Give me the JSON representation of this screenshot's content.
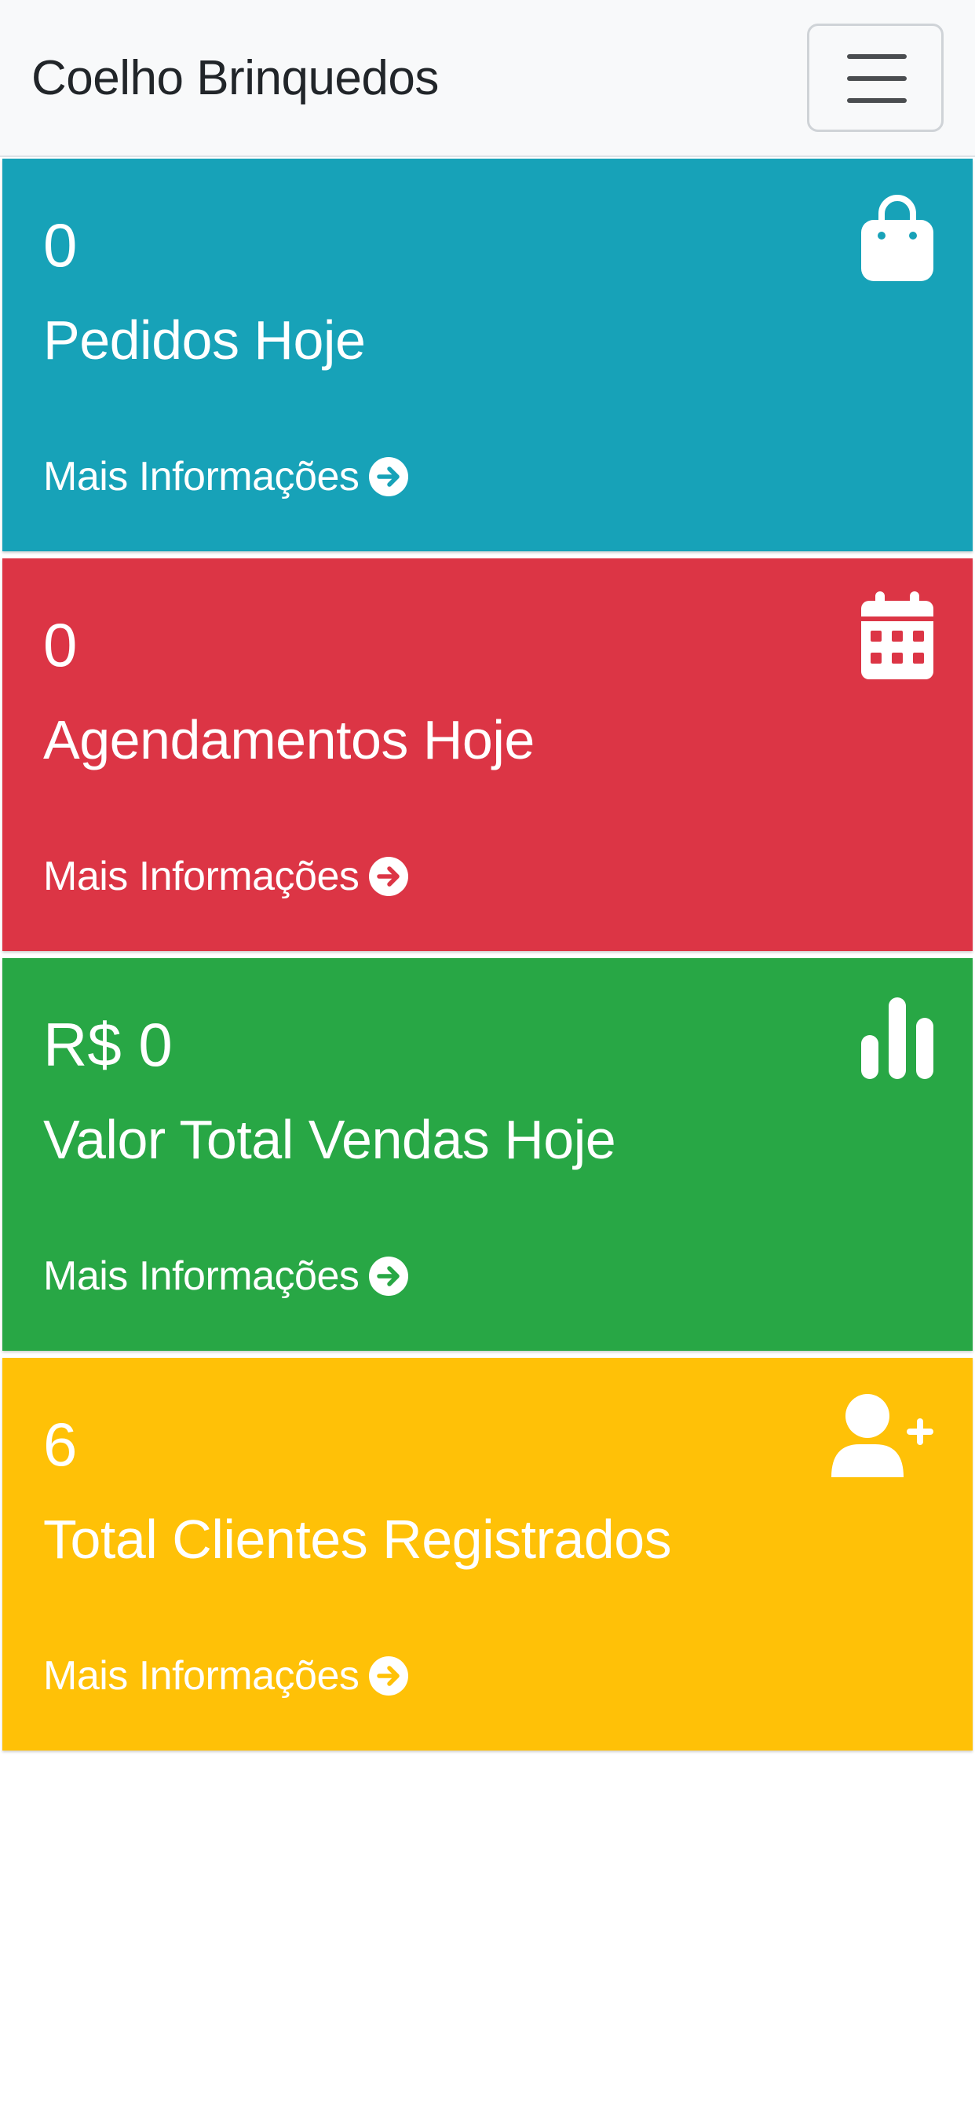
{
  "header": {
    "brand": "Coelho Brinquedos",
    "menu_icon": "hamburger-menu-icon"
  },
  "cards": [
    {
      "value": "0",
      "label": "Pedidos Hoje",
      "link": "Mais Informações",
      "icon": "shopping-bag-icon",
      "color": "#17a2b8"
    },
    {
      "value": "0",
      "label": "Agendamentos Hoje",
      "link": "Mais Informações",
      "icon": "calendar-icon",
      "color": "#dc3545"
    },
    {
      "value": "R$ 0",
      "label": "Valor Total Vendas Hoje",
      "link": "Mais Informações",
      "icon": "bar-chart-icon",
      "color": "#28a745"
    },
    {
      "value": "6",
      "label": "Total Clientes Registrados",
      "link": "Mais Informações",
      "icon": "user-plus-icon",
      "color": "#ffc107"
    }
  ]
}
